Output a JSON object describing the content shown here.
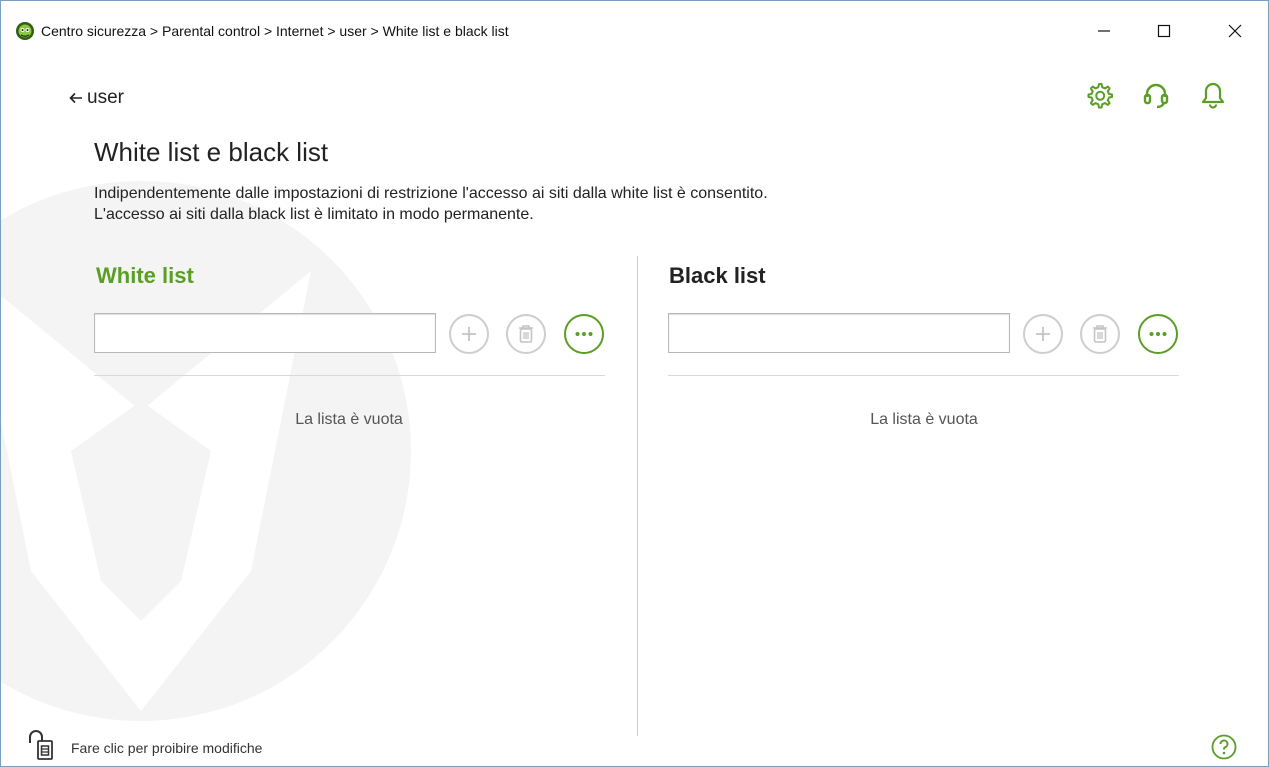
{
  "window": {
    "breadcrumb": "Centro sicurezza > Parental control > Internet > user > White list e black list"
  },
  "nav": {
    "back_label": "user"
  },
  "header_icons": [
    "settings-icon",
    "support-headset-icon",
    "notifications-bell-icon"
  ],
  "page": {
    "title": "White list e black list",
    "description_line1": "Indipendentemente dalle impostazioni di restrizione l'accesso ai siti dalla white list è consentito.",
    "description_line2": "L'accesso ai siti dalla black list è limitato in modo permanente."
  },
  "white_list": {
    "title": "White list",
    "input_value": "",
    "empty_text": "La lista è vuota",
    "buttons": {
      "add": "add-icon",
      "delete": "trash-icon",
      "more": "more-options-icon"
    }
  },
  "black_list": {
    "title": "Black list",
    "input_value": "",
    "empty_text": "La lista è vuota",
    "buttons": {
      "add": "add-icon",
      "delete": "trash-icon",
      "more": "more-options-icon"
    }
  },
  "footer": {
    "lock_label": "Fare clic per proibire modifiche"
  },
  "colors": {
    "accent_green": "#5a9e25",
    "disabled_gray": "#cdcdcd"
  }
}
